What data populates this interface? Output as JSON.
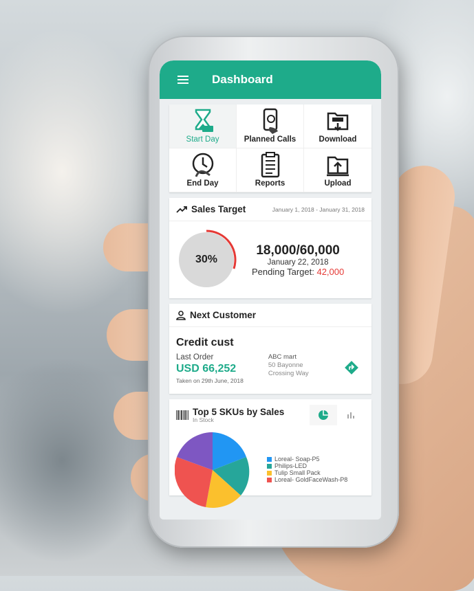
{
  "appbar": {
    "title": "Dashboard"
  },
  "tiles": [
    {
      "label": "Start Day",
      "icon": "hourglass-icon",
      "active": true
    },
    {
      "label": "Planned Calls",
      "icon": "phone-call-icon"
    },
    {
      "label": "Download",
      "icon": "download-icon"
    },
    {
      "label": "End Day",
      "icon": "clock-icon"
    },
    {
      "label": "Reports",
      "icon": "report-icon"
    },
    {
      "label": "Upload",
      "icon": "upload-icon"
    }
  ],
  "sales_target": {
    "heading": "Sales Target",
    "date_range": "January 1, 2018 - January 31, 2018",
    "percent": "30%",
    "progress_fraction": 0.3,
    "amount": "18,000/60,000",
    "date": "January 22, 2018",
    "pending_label": "Pending Target:",
    "pending_value": "42,000"
  },
  "next_customer": {
    "heading": "Next Customer",
    "name": "Credit cust",
    "last_order_label": "Last Order",
    "last_order_amount": "USD 66,252",
    "taken_on": "Taken on 29th June, 2018",
    "address_name": "ABC mart",
    "address_line1": "50 Bayonne",
    "address_line2": "Crossing Way"
  },
  "top_skus": {
    "heading": "Top 5 SKUs by Sales",
    "subheading": "In Stock",
    "legend": [
      {
        "label": "Loreal- Soap-P5",
        "color": "#2196f3"
      },
      {
        "label": "Philips-LED",
        "color": "#26a69a"
      },
      {
        "label": "Tulip Small Pack",
        "color": "#fbc02d"
      },
      {
        "label": "Loreal- GoldFaceWash-P8",
        "color": "#ef5350"
      }
    ]
  },
  "colors": {
    "accent": "#1eab8a",
    "alert": "#e53935"
  }
}
